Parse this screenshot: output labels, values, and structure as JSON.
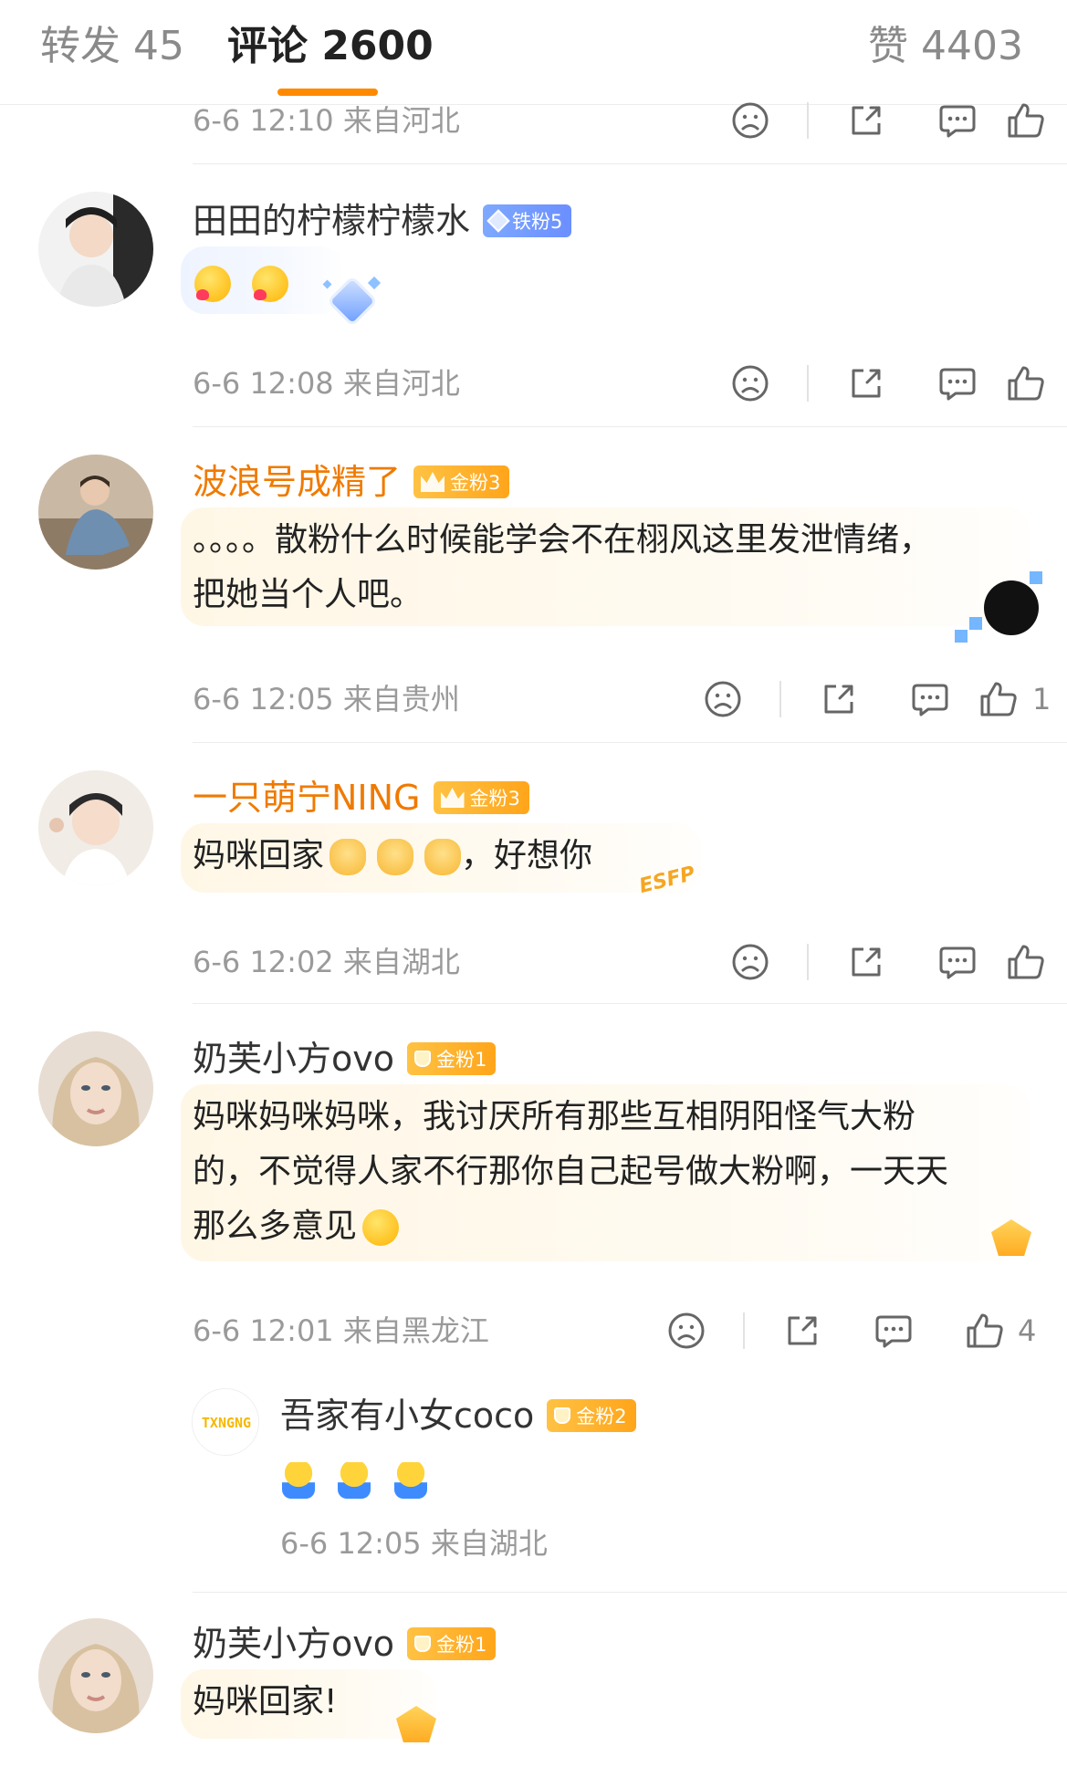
{
  "tabs": {
    "forward": "转发 45",
    "comments": "评论 2600",
    "likes": "赞 4403"
  },
  "colors": {
    "accent": "#ff8a00",
    "gold_name": "#f07a00",
    "meta": "#9a9a9a"
  },
  "icons": {
    "dislike": "frown-face-icon",
    "share": "share-icon",
    "reply": "comment-bubble-icon",
    "like": "thumbs-up-icon"
  },
  "top_partial": {
    "meta": "6-6 12:10 来自河北"
  },
  "comments": [
    {
      "username": "田田的柠檬柠檬水",
      "badge": "铁粉5",
      "text": "",
      "meta": "6-6 12:08 来自河北",
      "likes": ""
    },
    {
      "username": "波浪号成精了",
      "badge": "金粉3",
      "badge_level": "5",
      "text_line1": "。。。。散粉什么时候能学会不在栩风这里发泄情绪，",
      "text_line2": "把她当个人吧。",
      "meta": "6-6 12:05 来自贵州",
      "likes": "1"
    },
    {
      "username": "一只萌宁NING",
      "badge": "金粉3",
      "badge_level": "4",
      "text_prefix": "妈咪回家",
      "text_suffix": "，好想你",
      "sticker": "ESFP",
      "meta": "6-6 12:02 来自湖北",
      "likes": ""
    },
    {
      "username": "奶芙小方ovo",
      "badge": "金粉1",
      "text_line1": "妈咪妈咪妈咪，我讨厌所有那些互相阴阳怪气大粉",
      "text_line2": "的，不觉得人家不行那你自己起号做大粉啊，一天天",
      "text_line3": "那么多意见",
      "meta": "6-6 12:01 来自黑龙江",
      "likes": "4"
    },
    {
      "username": "吾家有小女coco",
      "badge": "金粉2",
      "avatar_text": "TXNGNG",
      "meta": "6-6 12:05 来自湖北"
    },
    {
      "username": "奶芙小方ovo",
      "badge": "金粉1",
      "text": "妈咪回家!"
    }
  ]
}
